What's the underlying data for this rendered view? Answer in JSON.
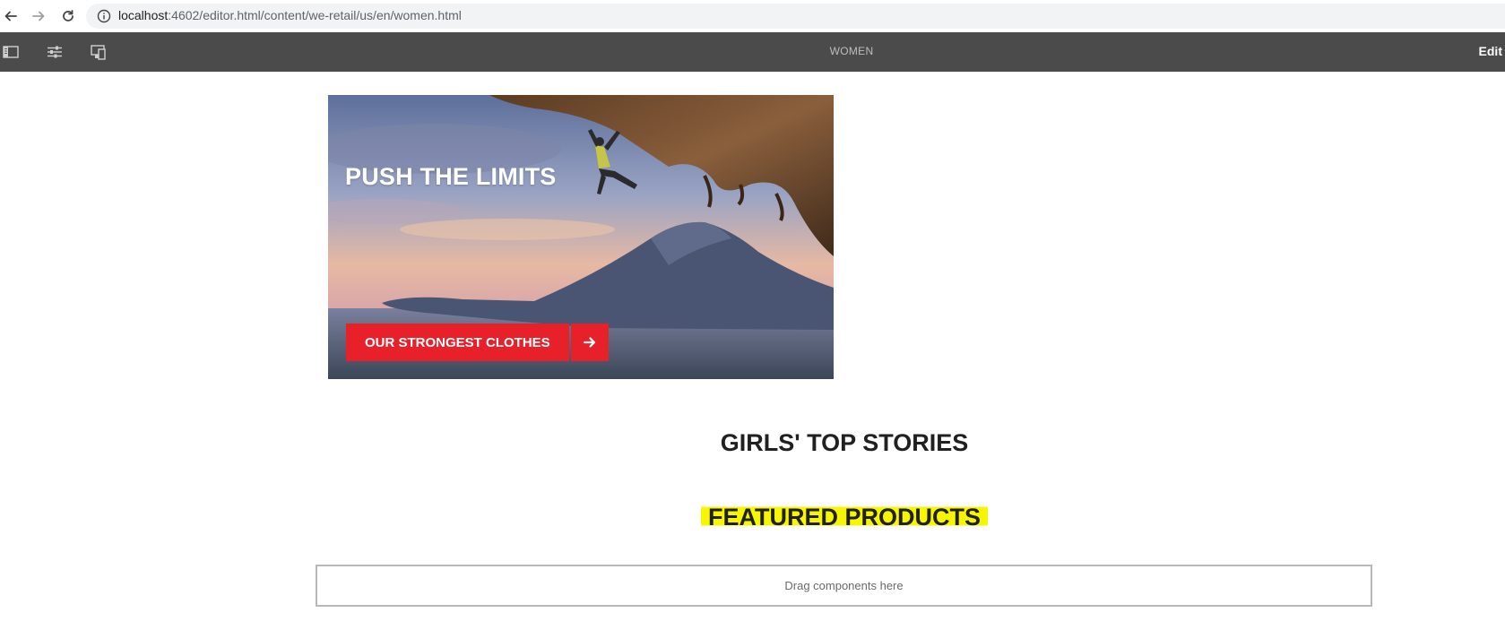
{
  "browser": {
    "url_host": "localhost",
    "url_path": ":4602/editor.html/content/we-retail/us/en/women.html",
    "icons": [
      "back-arrow-icon",
      "forward-arrow-icon",
      "reload-icon",
      "info-icon"
    ]
  },
  "editor": {
    "page_title": "WOMEN",
    "mode_label": "Edit",
    "icons": [
      "side-panel-icon",
      "properties-icon",
      "emulator-icon"
    ]
  },
  "hero": {
    "title": "PUSH THE LIMITS",
    "cta_label": "OUR STRONGEST CLOTHES",
    "cta_icon": "arrow-right-icon"
  },
  "sections": {
    "top_stories_title": "GIRLS' TOP STORIES",
    "featured_title": "FEATURED PRODUCTS"
  },
  "dropzone": {
    "label": "Drag components here"
  },
  "colors": {
    "toolbar": "#4b4b4b",
    "cta": "#e8202a",
    "highlight": "#f6f600"
  }
}
